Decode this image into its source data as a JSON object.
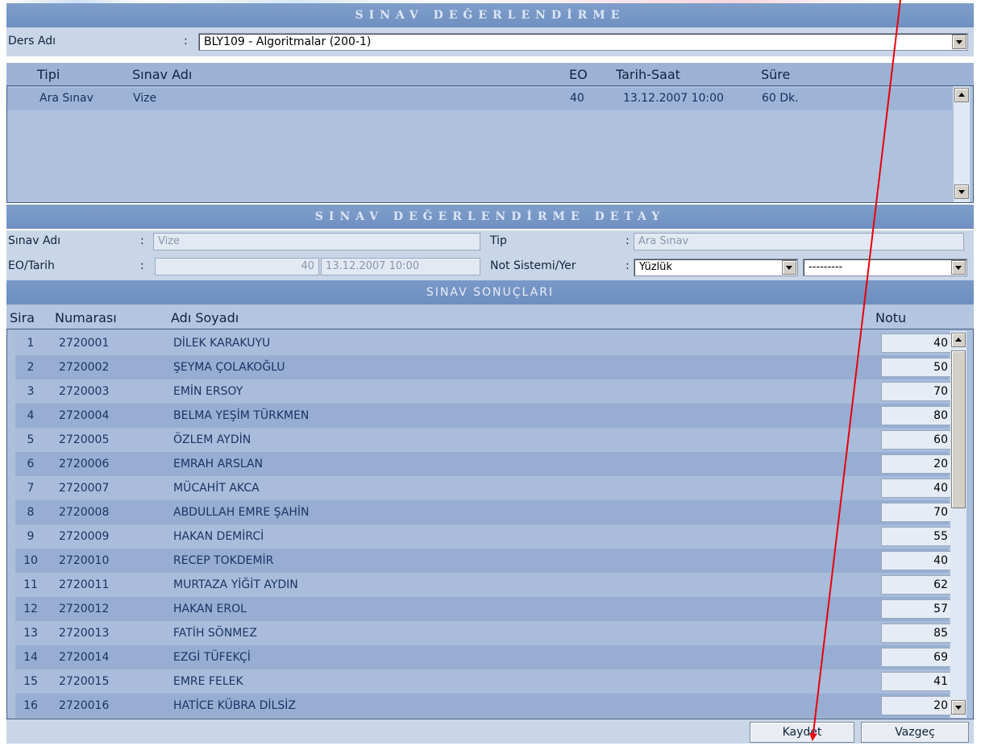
{
  "main_title": "SINAV DEĞERLENDİRME",
  "course": {
    "label": "Ders Adı",
    "colon": ":",
    "selected": "BLY109 - Algoritmalar (200-1)"
  },
  "exam_table": {
    "headers": {
      "type": "Tipi",
      "name": "Sınav Adı",
      "eo": "EO",
      "datetime": "Tarih-Saat",
      "duration": "Süre"
    },
    "rows": [
      {
        "type": "Ara Sınav",
        "name": "Vize",
        "eo": "40",
        "datetime": "13.12.2007 10:00",
        "duration": "60  Dk."
      }
    ]
  },
  "detail_title": "SINAV DEĞERLENDİRME DETAY",
  "detail": {
    "exam_name_label": "Sınav Adı",
    "exam_name_value": "Vize",
    "type_label": "Tip",
    "type_value": "Ara Sınav",
    "eo_date_label": "EO/Tarih",
    "eo_value": "40",
    "date_value": "13.12.2007 10:00",
    "grading_label": "Not Sistemi/Yer",
    "grading_value": "Yüzlük",
    "place_value": "---------",
    "colon": ":"
  },
  "results_title": "SINAV SONUÇLARI",
  "results": {
    "headers": {
      "sira": "Sira",
      "number": "Numarası",
      "name": "Adı Soyadı",
      "grade": "Notu"
    },
    "rows": [
      {
        "sira": "1",
        "number": "2720001",
        "name": "DİLEK KARAKUYU",
        "grade": "40"
      },
      {
        "sira": "2",
        "number": "2720002",
        "name": "ŞEYMA ÇOLAKOĞLU",
        "grade": "50"
      },
      {
        "sira": "3",
        "number": "2720003",
        "name": "EMİN ERSOY",
        "grade": "70"
      },
      {
        "sira": "4",
        "number": "2720004",
        "name": "BELMA YEŞİM TÜRKMEN",
        "grade": "80"
      },
      {
        "sira": "5",
        "number": "2720005",
        "name": "ÖZLEM AYDİN",
        "grade": "60"
      },
      {
        "sira": "6",
        "number": "2720006",
        "name": "EMRAH ARSLAN",
        "grade": "20"
      },
      {
        "sira": "7",
        "number": "2720007",
        "name": "MÜCAHİT AKCA",
        "grade": "40"
      },
      {
        "sira": "8",
        "number": "2720008",
        "name": "ABDULLAH EMRE ŞAHİN",
        "grade": "70"
      },
      {
        "sira": "9",
        "number": "2720009",
        "name": "HAKAN DEMİRCİ",
        "grade": "55"
      },
      {
        "sira": "10",
        "number": "2720010",
        "name": "RECEP TOKDEMİR",
        "grade": "40"
      },
      {
        "sira": "11",
        "number": "2720011",
        "name": "MURTAZA YİĞİT AYDIN",
        "grade": "62"
      },
      {
        "sira": "12",
        "number": "2720012",
        "name": "HAKAN EROL",
        "grade": "57"
      },
      {
        "sira": "13",
        "number": "2720013",
        "name": "FATİH SÖNMEZ",
        "grade": "85"
      },
      {
        "sira": "14",
        "number": "2720014",
        "name": "EZGİ TÜFEKÇİ",
        "grade": "69"
      },
      {
        "sira": "15",
        "number": "2720015",
        "name": "EMRE FELEK",
        "grade": "41"
      },
      {
        "sira": "16",
        "number": "2720016",
        "name": "HATİCE KÜBRA DİLSİZ",
        "grade": "20"
      }
    ]
  },
  "buttons": {
    "save": "Kaydet",
    "cancel": "Vazgeç"
  },
  "colors": {
    "annotation_arrow": "#e8000b",
    "header_band": "#7393c4"
  }
}
